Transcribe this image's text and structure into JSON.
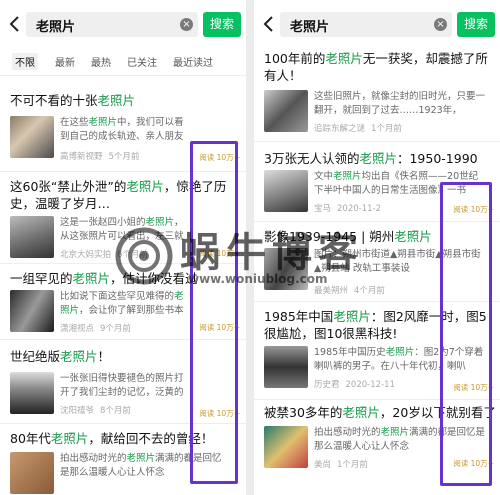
{
  "search": {
    "query": "老照片",
    "button": "搜索",
    "clear": "×"
  },
  "filters": [
    "不限",
    "最新",
    "最热",
    "已关注",
    "最近读过"
  ],
  "left_articles": [
    {
      "title": "不可不看的十张老照片",
      "snippet": "在这些老照片中，我们可以看到自己的成长轨迹、亲人朋友的容颜与笑容，以及那些珍贵的时光",
      "source": "高博新视野",
      "time": "5个月前",
      "reads": "阅读 10万+"
    },
    {
      "title": "这60张“禁止外泄”的老照片，惊艳了历史，温暖了岁月…",
      "snippet": "这是一张赵四小姐的老照片，从这张照片可以看出，左三就是赵四小姐。",
      "source": "北京大妈实拍",
      "time": "6个月前",
      "reads": "阅读 10万+"
    },
    {
      "title": "一组罕见的老照片，估计你没看过",
      "snippet": "比如说下面这些罕见难得的老照片，会让你了解到那些书本上学不到的东西。",
      "source": "潇湘视点",
      "time": "9个月前",
      "reads": "阅读 10万+"
    },
    {
      "title": "世纪绝版老照片！",
      "snippet": "一张张旧得快要褪色的照片打开了我们尘封的记忆，泛黄的老照片记录了一个时代",
      "source": "沈阳禧爷",
      "time": "8个月前",
      "reads": "阅读 10万+"
    },
    {
      "title": "80年代老照片，献给回不去的曾经！",
      "snippet": "拍出感动时光的老照片满满的都是回忆是那么温暖人心让人怀念",
      "source": "",
      "time": "",
      "reads": ""
    }
  ],
  "right_articles": [
    {
      "title": "100年前的老照片无一获奖，却震撼了所有人！",
      "snippet": "这些旧照片，就像尘封的旧时光，只要一翻开，就回到了过去……1923年，",
      "source": "追踪东解之谜",
      "time": "1个月前",
      "reads": ""
    },
    {
      "title": "3万张无人认领的老照片：1950-1990",
      "snippet": "文中老照片均出自《佚名照——20世纪下半叶中国人的日常生活图像》一书",
      "source": "宝马",
      "time": "2020-11-2",
      "reads": "阅读 10万+"
    },
    {
      "title": "影像1939-1945 | 朔州老照片",
      "snippet": "图片：朔州市街道▲朔县市街▲朔县市街▲朔县站 改轨工事装设",
      "source": "最美朔州",
      "time": "4个月前",
      "reads": ""
    },
    {
      "title": "1985年中国老照片：图2风靡一时，图5很尴尬，图10很黑科技!",
      "snippet": "1985年中国历史老照片：图2为7个穿着喇叭裤的男子。在八十年代初，喇叭",
      "source": "历史君",
      "time": "2020-12-11",
      "reads": "阅读 10万+"
    },
    {
      "title": "被禁30多年的老照片，20岁以下就别看了",
      "snippet": "拍出感动时光的老照片满满的都是回忆是那么温暖人心让人怀念",
      "source": "美尚",
      "time": "1个月前",
      "reads": "阅读 10万+"
    }
  ],
  "watermark": {
    "text": "蜗牛博客",
    "url": "www.woniublog.com"
  },
  "colors": {
    "accent": "#07c160",
    "highlight": "#1a9c4e",
    "box": "#6633cc",
    "read": "#c79a2a"
  }
}
